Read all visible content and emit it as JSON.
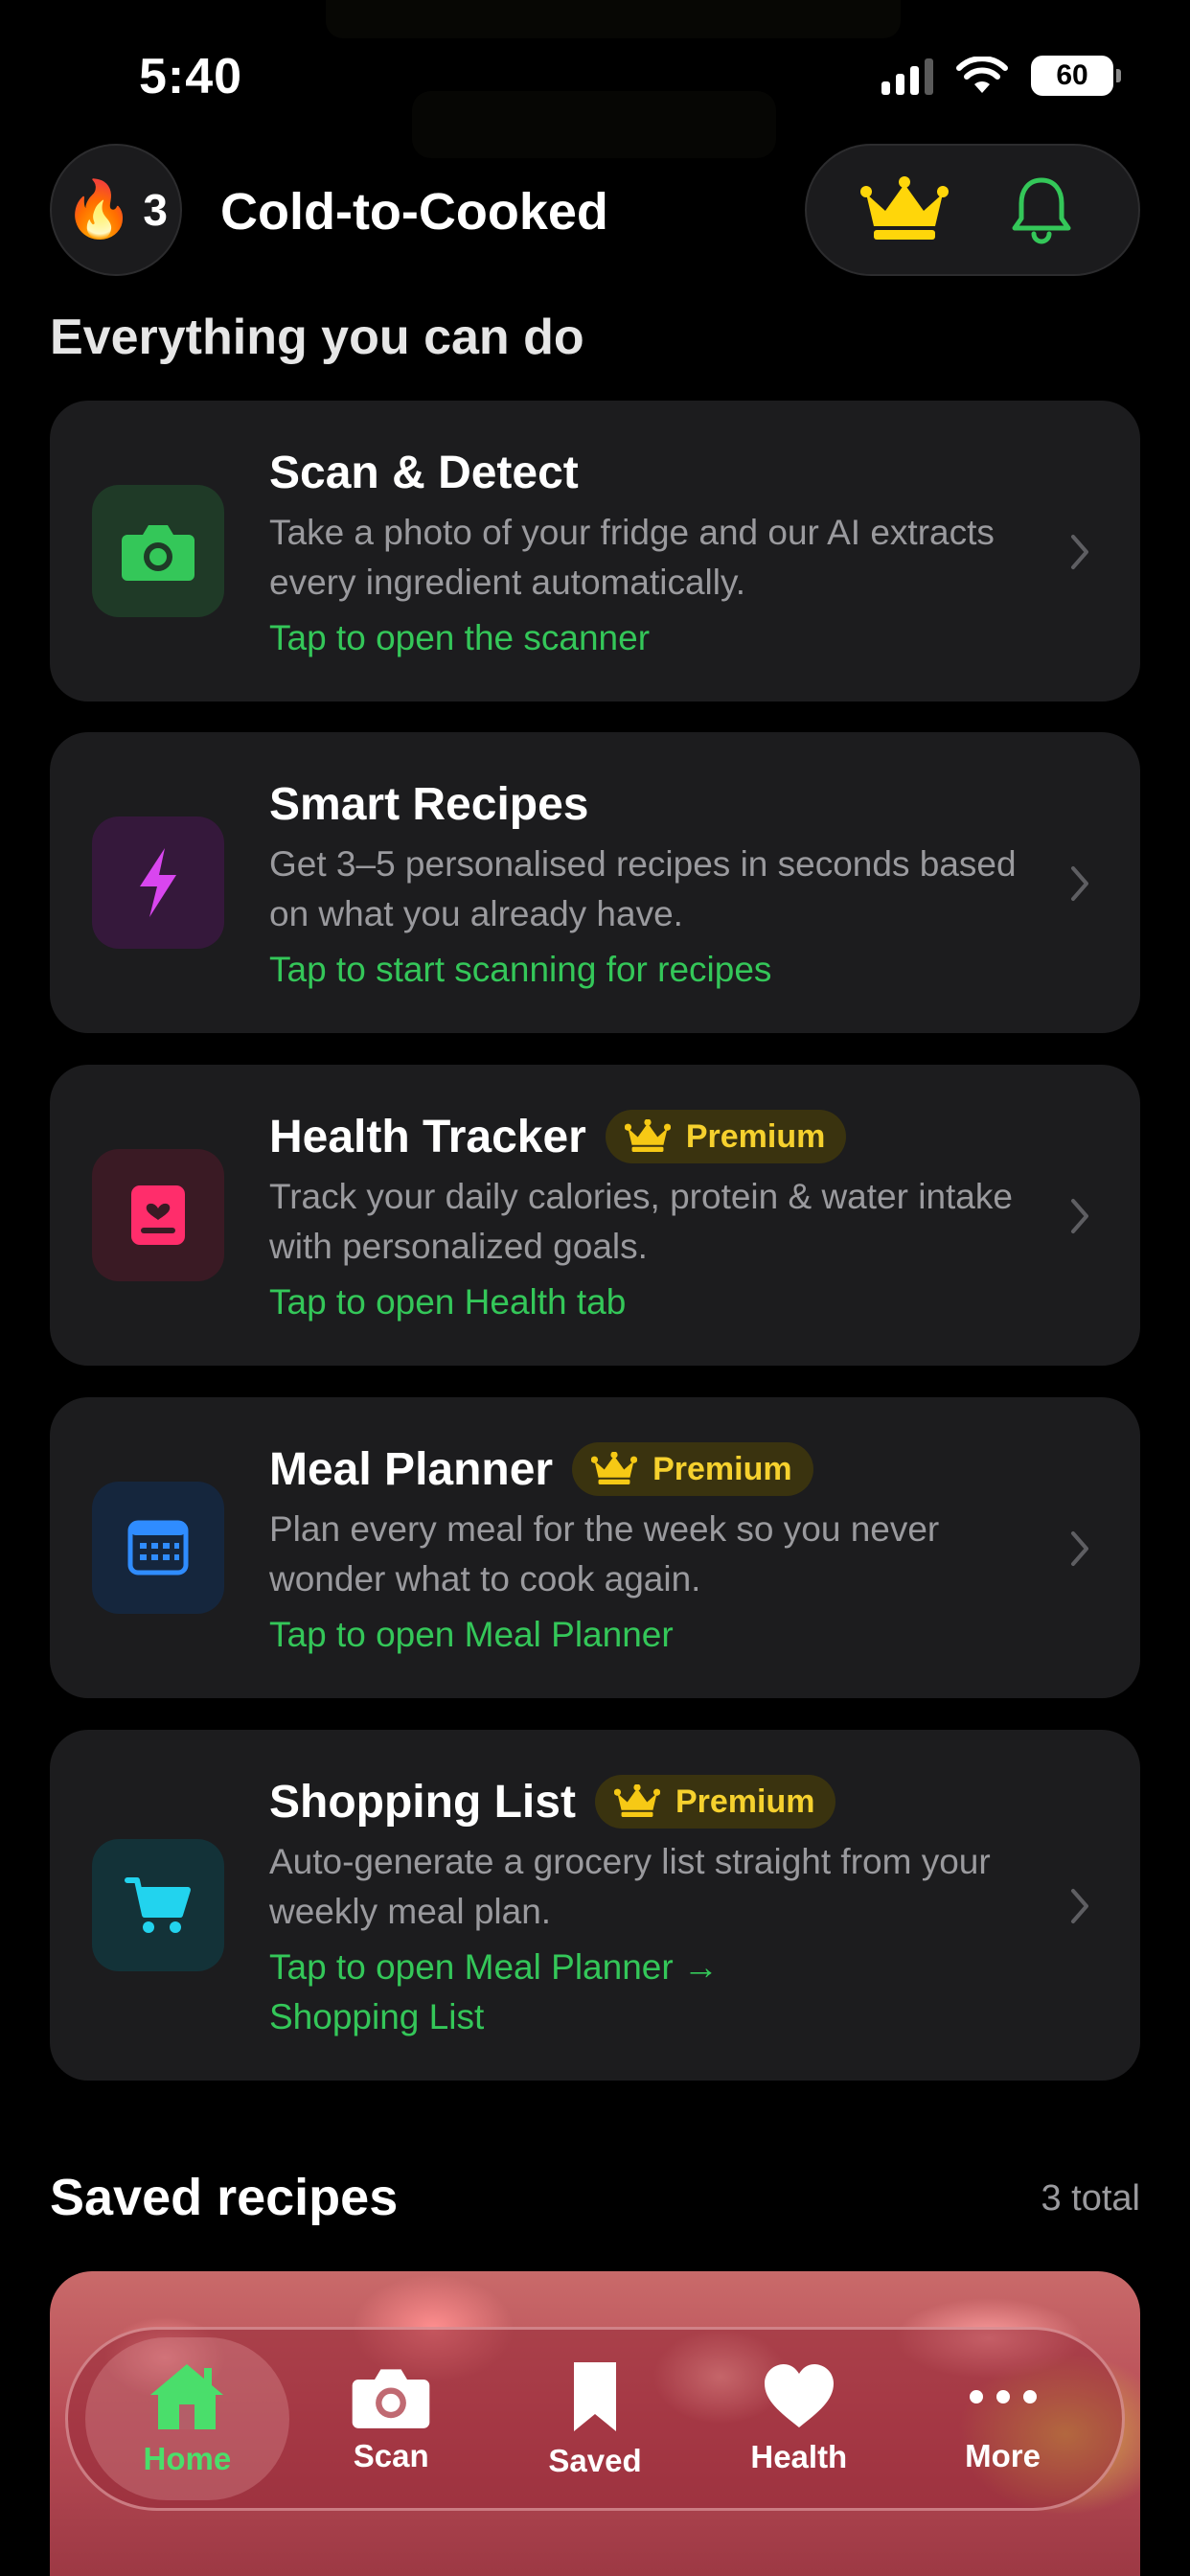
{
  "status_bar": {
    "time": "5:40",
    "battery": "60"
  },
  "header": {
    "streak_count": "3",
    "app_title": "Cold-to-Cooked"
  },
  "section_title": "Everything you can do",
  "features": [
    {
      "title": "Scan & Detect",
      "premium": false,
      "description": "Take a photo of your fridge and our AI extracts every ingredient automatically.",
      "cta": "Tap to open the scanner",
      "icon": "camera-icon",
      "color": "#34c759"
    },
    {
      "title": "Smart Recipes",
      "premium": false,
      "description": "Get 3–5 personalised recipes in seconds based on what you already have.",
      "cta": "Tap to start scanning for recipes",
      "icon": "lightning-icon",
      "color": "#d946ef"
    },
    {
      "title": "Health Tracker",
      "premium": true,
      "badge": "Premium",
      "description": "Track your daily calories, protein & water intake with personalized goals.",
      "cta": "Tap to open Health tab",
      "icon": "health-card-icon",
      "color": "#ff2d6b"
    },
    {
      "title": "Meal Planner",
      "premium": true,
      "badge": "Premium",
      "description": "Plan every meal for the week so you never wonder what to cook again.",
      "cta": "Tap to open Meal Planner",
      "icon": "calendar-icon",
      "color": "#2f8cff"
    },
    {
      "title": "Shopping List",
      "premium": true,
      "badge": "Premium",
      "description": "Auto-generate a grocery list straight from your weekly meal plan.",
      "cta": "Tap to open Meal Planner → Shopping List",
      "icon": "cart-icon",
      "color": "#22d3ee"
    }
  ],
  "saved": {
    "title": "Saved recipes",
    "count": "3 total"
  },
  "tabs": [
    {
      "label": "Home",
      "icon": "home-icon",
      "active": true
    },
    {
      "label": "Scan",
      "icon": "camera-icon",
      "active": false
    },
    {
      "label": "Saved",
      "icon": "bookmark-icon",
      "active": false
    },
    {
      "label": "Health",
      "icon": "heart-icon",
      "active": false
    },
    {
      "label": "More",
      "icon": "more-icon",
      "active": false
    }
  ],
  "colors": {
    "accent_green": "#34c759",
    "premium_gold": "#f6d12e",
    "card_bg": "#1c1c1e"
  }
}
